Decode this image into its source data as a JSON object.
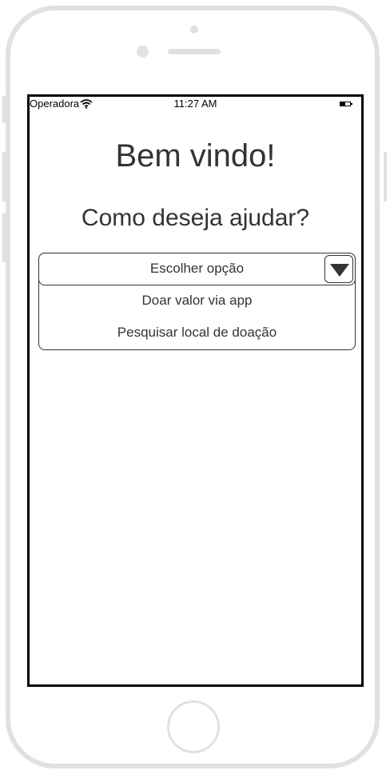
{
  "status_bar": {
    "carrier": "Operadora",
    "time": "11:27 AM",
    "wifi_icon": "wifi-icon",
    "battery_icon": "battery-icon"
  },
  "main": {
    "title": "Bem vindo!",
    "subtitle": "Como deseja ajudar?"
  },
  "dropdown": {
    "selected": "Escolher opção",
    "arrow_icon": "triangle-down-icon",
    "options": [
      {
        "label": "Doar valor via app"
      },
      {
        "label": "Pesquisar local de doação"
      }
    ]
  },
  "colors": {
    "frame": "#e1e1e4",
    "text": "#333333",
    "screen_border": "#000000"
  }
}
